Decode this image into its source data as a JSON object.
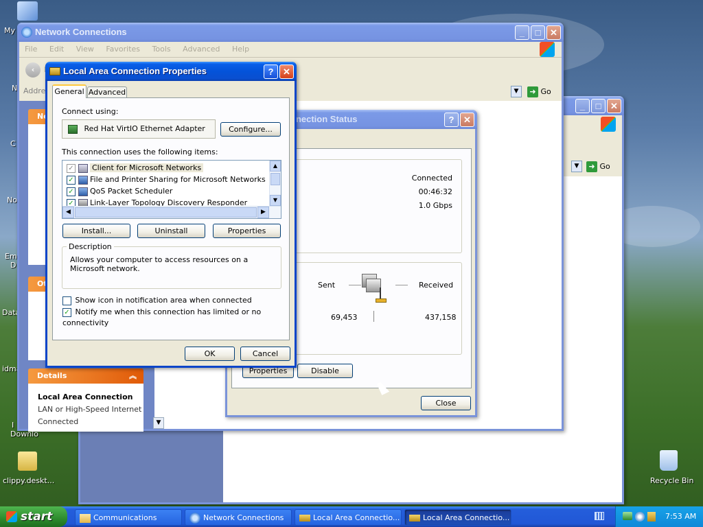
{
  "desktop": {
    "icons": [
      {
        "label": "My",
        "icon": "my-computer-icon"
      },
      {
        "label": "clippy.deskt...",
        "icon": "zip-folder-icon"
      },
      {
        "label": "Recycle Bin",
        "icon": "recycle-bin-icon"
      }
    ],
    "partial_labels": [
      "N",
      "C",
      "No",
      "Em",
      "D",
      "Data",
      "idma",
      "I",
      "Downlo"
    ]
  },
  "network_window": {
    "title": "Network Connections",
    "menu": [
      "File",
      "Edit",
      "View",
      "Favorites",
      "Tools",
      "Advanced",
      "Help"
    ],
    "address_label": "Address",
    "go_label": "Go",
    "back_label": "B",
    "sidebar": {
      "sections": [
        {
          "title": "Ne",
          "icon": "network-tasks-icon"
        },
        {
          "title": "Ot",
          "icon": "other-places-icon"
        }
      ],
      "details": {
        "title": "Details",
        "name": "Local Area Connection",
        "type": "LAN or High-Speed Internet",
        "status": "Connected"
      }
    }
  },
  "second_explorer": {
    "go_label": "Go"
  },
  "status_window": {
    "title": "nnection Status",
    "connection": {
      "status": "Connected",
      "duration": "00:46:32",
      "speed": "1.0 Gbps"
    },
    "activity": {
      "sent_label": "Sent",
      "received_label": "Received",
      "sent_value": "69,453",
      "received_value": "437,158"
    },
    "buttons": {
      "properties": "Properties",
      "disable": "Disable",
      "close": "Close"
    }
  },
  "props_dialog": {
    "title": "Local Area Connection Properties",
    "tabs": [
      "General",
      "Advanced"
    ],
    "connect_using_label": "Connect using:",
    "adapter": "Red Hat VirtIO Ethernet Adapter",
    "configure_label": "Configure...",
    "items_label": "This connection uses the following items:",
    "items": [
      {
        "label": "Client for Microsoft Networks",
        "checked": true
      },
      {
        "label": "File and Printer Sharing for Microsoft Networks",
        "checked": true
      },
      {
        "label": "QoS Packet Scheduler",
        "checked": true
      },
      {
        "label": "Link-Layer Topology Discovery Responder",
        "checked": true
      }
    ],
    "buttons": {
      "install": "Install...",
      "uninstall": "Uninstall",
      "properties": "Properties",
      "ok": "OK",
      "cancel": "Cancel"
    },
    "description_title": "Description",
    "description_text": "Allows your computer to access resources on a Microsoft network.",
    "show_icon_label": "Show icon in notification area when connected",
    "show_icon_checked": false,
    "notify_label": "Notify me when this connection has limited or no connectivity",
    "notify_checked": true
  },
  "taskbar": {
    "start_label": "start",
    "tasks": [
      {
        "label": "Communications",
        "icon": "folder-icon",
        "active": false
      },
      {
        "label": "Network Connections",
        "icon": "network-icon",
        "active": false
      },
      {
        "label": "Local Area Connectio...",
        "icon": "lan-icon",
        "active": false
      },
      {
        "label": "Local Area Connectio...",
        "icon": "lan-icon",
        "active": true
      }
    ],
    "clock": "7:53 AM"
  }
}
